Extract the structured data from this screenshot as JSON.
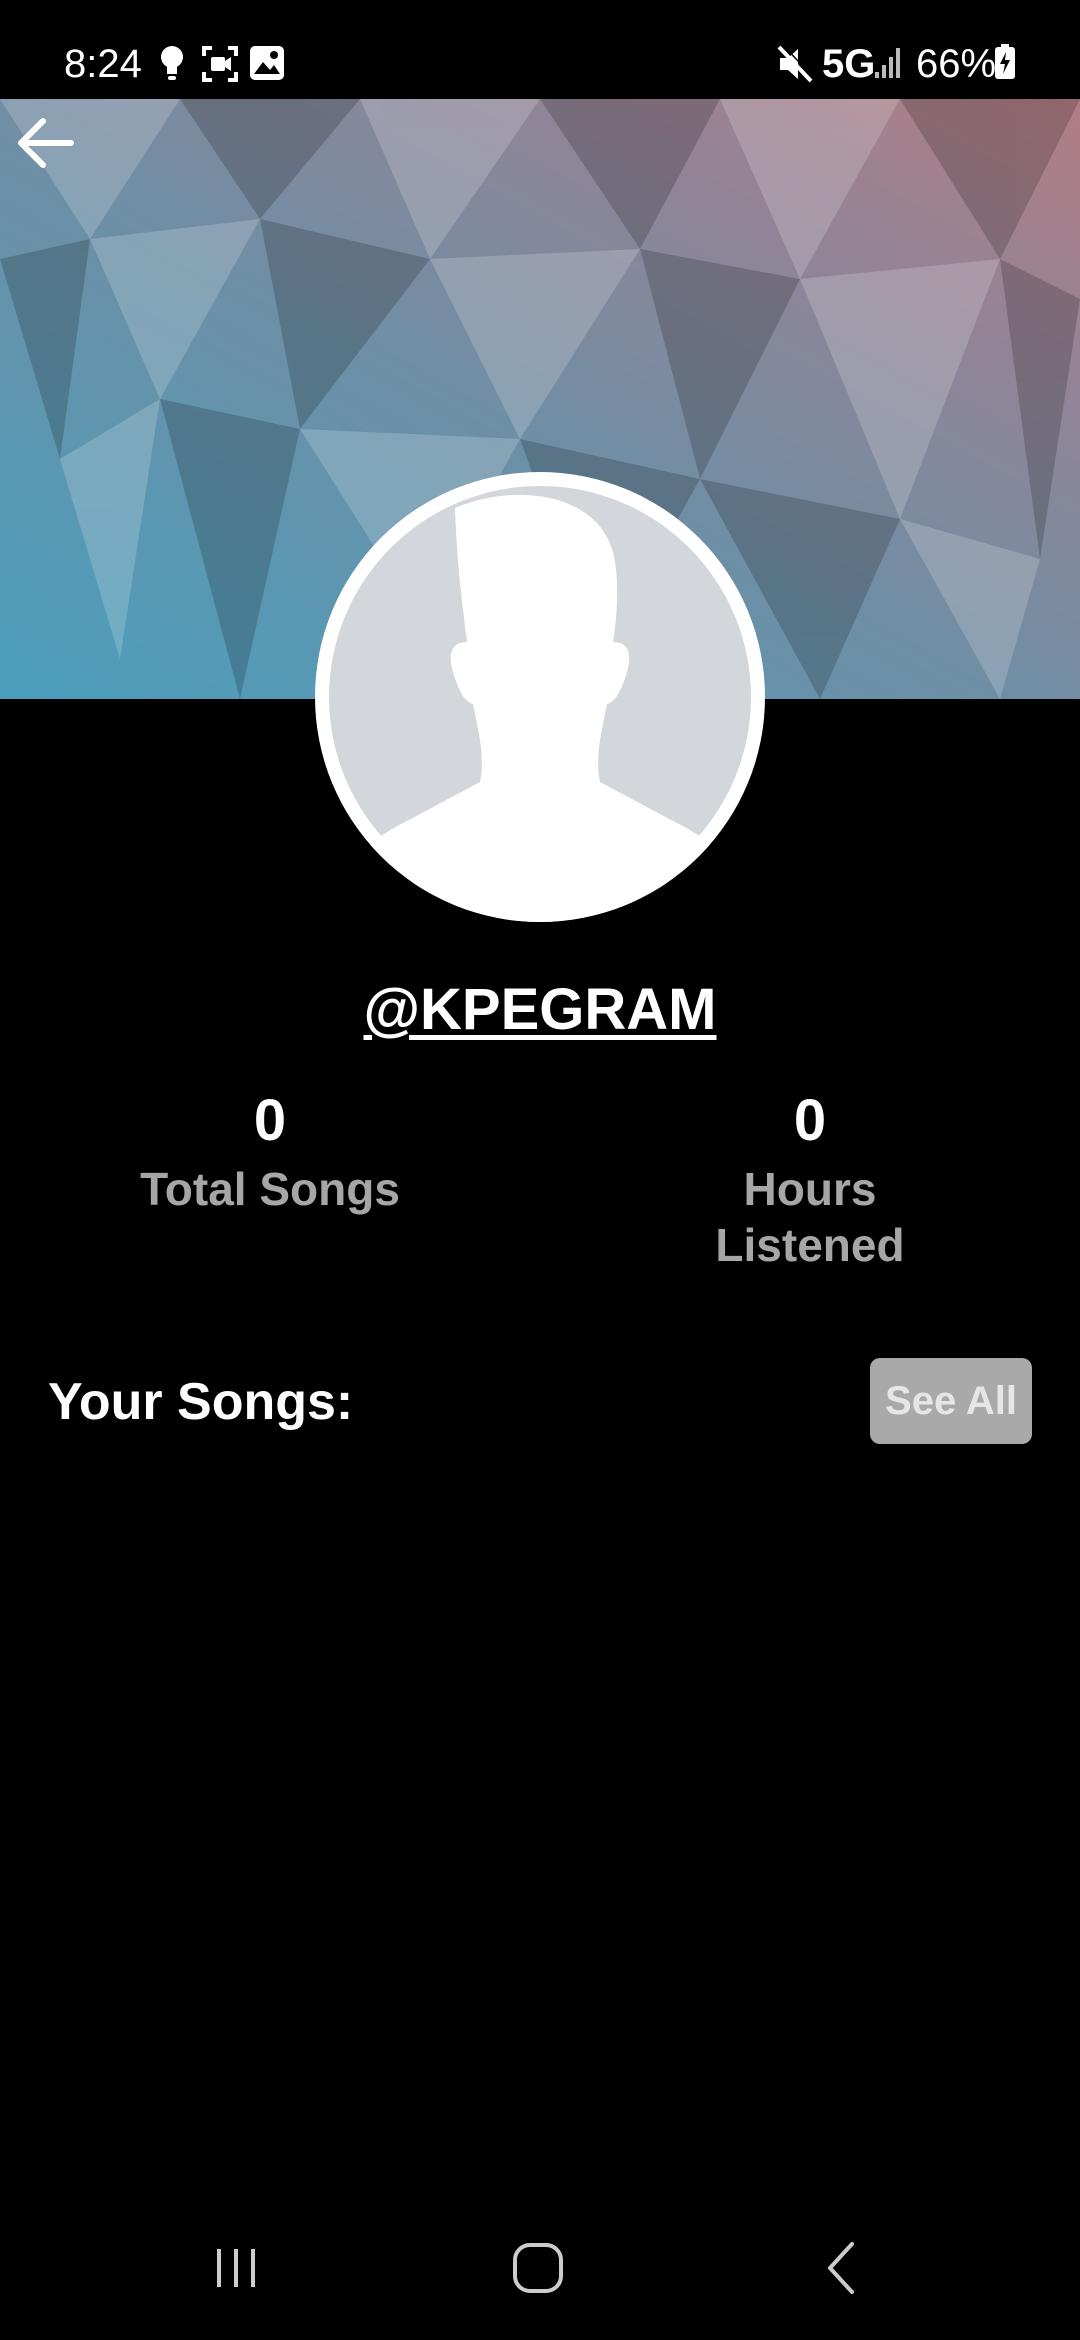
{
  "status_bar": {
    "time": "8:24",
    "network": "5G",
    "battery": "66%",
    "icons": [
      "bulb-icon",
      "screen-record-icon",
      "gallery-icon",
      "mute-icon",
      "signal-icon",
      "battery-icon"
    ]
  },
  "header": {
    "back_icon": "arrow-left-icon"
  },
  "profile": {
    "username": "@KPEGRAM",
    "avatar_icon": "default-avatar-icon"
  },
  "stats": {
    "songs_value": "0",
    "songs_label": "Total Songs",
    "hours_value": "0",
    "hours_label": "Hours Listened"
  },
  "songs_section": {
    "title": "Your Songs:",
    "see_all_label": "See All"
  },
  "nav_bar": {
    "icons": [
      "recent-apps-icon",
      "home-icon",
      "back-icon"
    ]
  },
  "colors": {
    "background": "#000000",
    "banner_left": "#4a9fbd",
    "banner_right": "#b07a82",
    "label_gray": "#a6a6a6",
    "button_gray": "#a9a9a9"
  }
}
